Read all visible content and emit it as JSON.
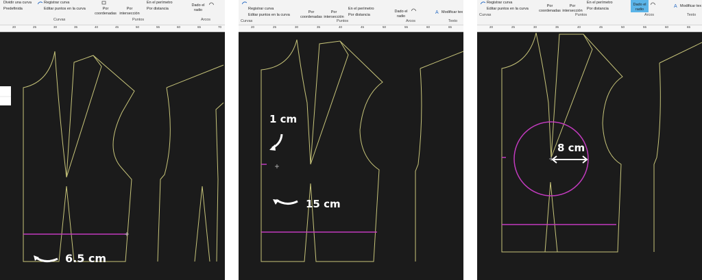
{
  "panel1": {
    "ribbon": {
      "items": [
        "Dividir una curva",
        "Predefinida",
        "Registrar curva",
        "Editar puntos en la curva",
        "Por coordenadas",
        "Por intersección",
        "En el perímetro",
        "Por distancia",
        "Dado el radio"
      ],
      "groups": [
        "Curvas",
        "Puntos",
        "Arcos"
      ]
    },
    "ruler": [
      "20",
      "25",
      "30",
      "35",
      "40",
      "45",
      "50",
      "55",
      "60",
      "65",
      "70"
    ],
    "annotation": "6.5 cm"
  },
  "panel2": {
    "ribbon": {
      "items": [
        "Registrar curva",
        "Editar puntos en la curva",
        "Por coordenadas",
        "Por intersección",
        "En el perímetro",
        "Por distancia",
        "Dado el radio",
        "Modificar tex"
      ],
      "groups": [
        "Curvas",
        "Puntos",
        "Arcos",
        "Texto"
      ]
    },
    "ruler": [
      "20",
      "25",
      "30",
      "35",
      "40",
      "45",
      "50",
      "55",
      "60",
      "65"
    ],
    "annotations": [
      "1 cm",
      "15 cm"
    ]
  },
  "panel3": {
    "ribbon": {
      "items": [
        "Registrar curva",
        "Editar puntos en la curva",
        "Por coordenadas",
        "Por intersección",
        "En el perímetro",
        "Por distancia",
        "Dado el radio",
        "Modificar tex"
      ],
      "groups": [
        "Curvas",
        "Puntos",
        "Arcos",
        "Texto"
      ]
    },
    "ruler": [
      "20",
      "25",
      "30",
      "35",
      "40",
      "45",
      "50",
      "55",
      "60",
      "65"
    ],
    "annotation": "8 cm"
  },
  "colors": {
    "pattern_line": "#c8c57a",
    "guide_line": "#c33bbf",
    "canvas": "#1b1b1b",
    "accent": "#5bb4e8"
  },
  "icons": [
    "curve-icon",
    "point-icon",
    "arc-icon",
    "text-icon",
    "arrow-curved-icon"
  ]
}
